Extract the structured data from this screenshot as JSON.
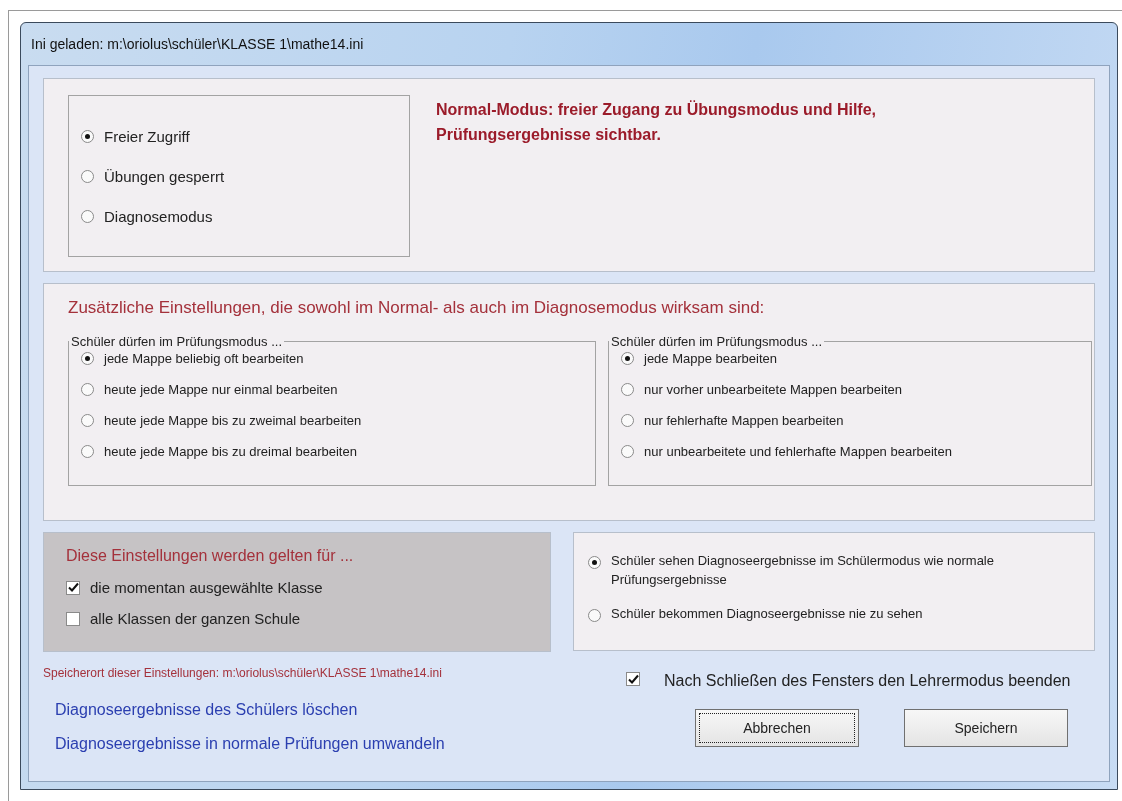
{
  "window": {
    "title": "Ini geladen: m:\\oriolus\\schüler\\KLASSE 1\\mathe14.ini"
  },
  "access_mode": {
    "options": [
      {
        "label": "Freier Zugriff",
        "selected": true
      },
      {
        "label": "Übungen gesperrt",
        "selected": false
      },
      {
        "label": "Diagnosemodus",
        "selected": false
      }
    ],
    "description": "Normal-Modus: freier Zugang zu Übungsmodus und Hilfe, Prüfungsergebnisse sichtbar."
  },
  "additional_settings": {
    "heading": "Zusätzliche Einstellungen, die sowohl im Normal- als auch im Diagnosemodus wirksam sind:",
    "groups": [
      {
        "legend": "Schüler dürfen im Prüfungsmodus ...",
        "options": [
          {
            "label": "jede Mappe beliebig oft bearbeiten",
            "selected": true
          },
          {
            "label": "heute jede Mappe nur einmal bearbeiten",
            "selected": false
          },
          {
            "label": "heute jede Mappe bis zu zweimal bearbeiten",
            "selected": false
          },
          {
            "label": "heute jede Mappe bis zu dreimal bearbeiten",
            "selected": false
          }
        ]
      },
      {
        "legend": "Schüler dürfen im Prüfungsmodus ...",
        "options": [
          {
            "label": "jede Mappe bearbeiten",
            "selected": true
          },
          {
            "label": "nur vorher unbearbeitete Mappen bearbeiten",
            "selected": false
          },
          {
            "label": "nur fehlerhafte Mappen bearbeiten",
            "selected": false
          },
          {
            "label": "nur unbearbeitete und fehlerhafte Mappen bearbeiten",
            "selected": false
          }
        ]
      }
    ]
  },
  "scope": {
    "heading": "Diese Einstellungen werden gelten für ...",
    "options": [
      {
        "label": "die momentan ausgewählte Klasse",
        "checked": true
      },
      {
        "label": "alle Klassen der ganzen Schule",
        "checked": false
      }
    ]
  },
  "diagnosis_visibility": {
    "options": [
      {
        "label": "Schüler sehen Diagnoseergebnisse im Schülermodus wie normale Prüfungsergebnisse",
        "selected": true
      },
      {
        "label": "Schüler bekommen Diagnoseergebnisse nie zu sehen",
        "selected": false
      }
    ]
  },
  "storage_location": "Speicherort dieser Einstellungen: m:\\oriolus\\schüler\\KLASSE 1\\mathe14.ini",
  "links": [
    "Diagnoseergebnisse des Schülers löschen",
    "Diagnoseergebnisse in normale Prüfungen umwandeln"
  ],
  "end_teacher_mode": {
    "label": "Nach Schließen des Fensters den Lehrermodus beenden",
    "checked": true
  },
  "buttons": [
    {
      "label": "Abbrechen",
      "focused": true
    },
    {
      "label": "Speichern",
      "focused": false
    }
  ]
}
